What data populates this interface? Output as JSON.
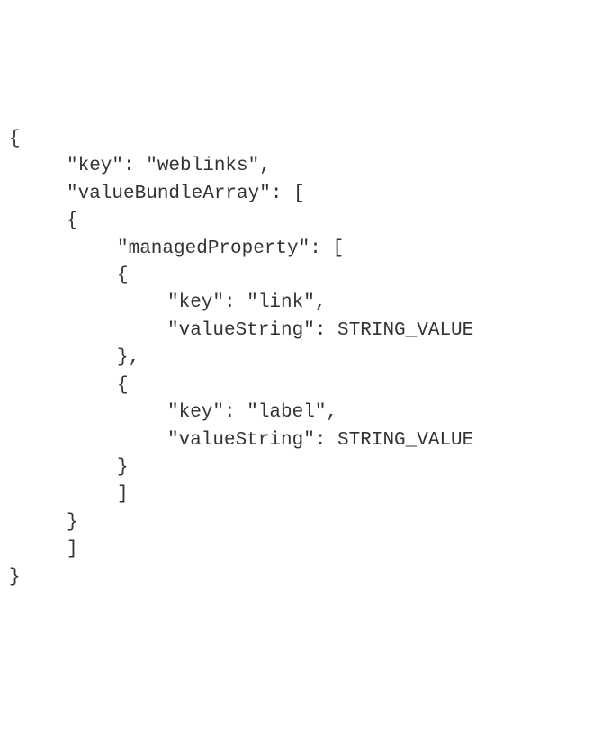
{
  "code": {
    "lines": [
      {
        "indent": 0,
        "text": "{"
      },
      {
        "indent": 1,
        "text": "\"key\": \"weblinks\","
      },
      {
        "indent": 1,
        "text": "\"valueBundleArray\": ["
      },
      {
        "indent": 1,
        "text": "{"
      },
      {
        "indent": 2,
        "text": "\"managedProperty\": ["
      },
      {
        "indent": 2,
        "text": "{"
      },
      {
        "indent": 3,
        "text": "\"key\": \"link\","
      },
      {
        "indent": 3,
        "text": "\"valueString\": STRING_VALUE"
      },
      {
        "indent": 2,
        "text": "},"
      },
      {
        "indent": 2,
        "text": "{"
      },
      {
        "indent": 3,
        "text": "\"key\": \"label\","
      },
      {
        "indent": 3,
        "text": "\"valueString\": STRING_VALUE"
      },
      {
        "indent": 2,
        "text": "}"
      },
      {
        "indent": 2,
        "text": "]"
      },
      {
        "indent": 1,
        "text": "}"
      },
      {
        "indent": 1,
        "text": "]"
      },
      {
        "indent": 0,
        "text": "}"
      }
    ]
  }
}
